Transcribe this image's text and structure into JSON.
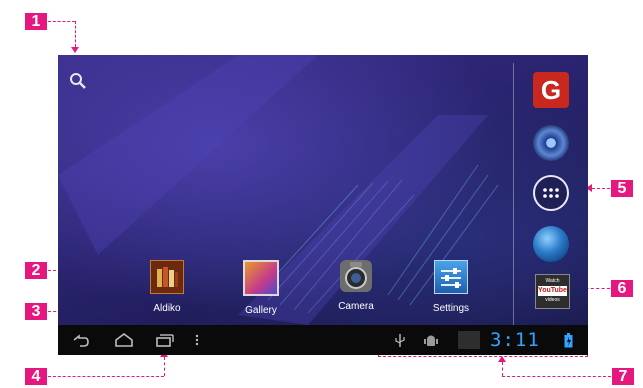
{
  "callouts": {
    "c1": "1",
    "c2": "2",
    "c3": "3",
    "c4": "4",
    "c5": "5",
    "c6": "6",
    "c7": "7"
  },
  "home_screen": {
    "search_icon": "search-icon",
    "apps": [
      {
        "label": "Aldiko",
        "icon": "aldiko-icon"
      },
      {
        "label": "Gallery",
        "icon": "gallery-icon"
      },
      {
        "label": "Camera",
        "icon": "camera-icon"
      },
      {
        "label": "Settings",
        "icon": "settings-icon"
      }
    ]
  },
  "dock": {
    "items": [
      {
        "icon": "google-g-icon",
        "glyph": "G"
      },
      {
        "icon": "music-icon"
      },
      {
        "icon": "all-apps-icon"
      },
      {
        "icon": "browser-globe-icon"
      },
      {
        "icon": "youtube-icon"
      }
    ],
    "youtube_text": {
      "top": "Watch",
      "mid": "YouTube",
      "bottom": "videos"
    }
  },
  "system_bar": {
    "nav_icons": [
      "back-icon",
      "home-icon",
      "recent-apps-icon",
      "menu-icon"
    ],
    "status_icons": [
      "usb-icon",
      "android-debug-icon",
      "notification-icon",
      "battery-icon"
    ],
    "clock": "3:11"
  },
  "colors": {
    "callout": "#e6177f",
    "clock": "#33a3ff",
    "wallpaper": "#2a2470",
    "system_bar": "#0a0a0a"
  }
}
